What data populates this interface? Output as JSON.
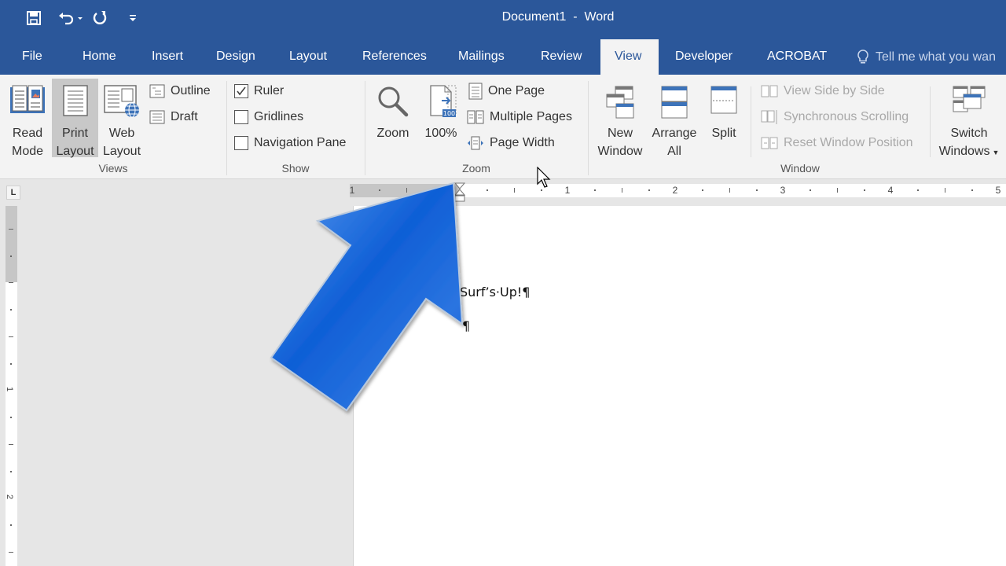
{
  "window": {
    "title": "Document1  -  Word"
  },
  "quick_access": {
    "save_icon": "save-icon",
    "undo_icon": "undo-icon",
    "redo_icon": "redo-icon",
    "customize_icon": "customize-qat-icon"
  },
  "tabs": [
    {
      "label": "File"
    },
    {
      "label": "Home"
    },
    {
      "label": "Insert"
    },
    {
      "label": "Design"
    },
    {
      "label": "Layout"
    },
    {
      "label": "References"
    },
    {
      "label": "Mailings"
    },
    {
      "label": "Review"
    },
    {
      "label": "View",
      "active": true
    },
    {
      "label": "Developer"
    },
    {
      "label": "ACROBAT"
    }
  ],
  "tell_me": {
    "placeholder": "Tell me what you want to do",
    "visible_text": "Tell me what you wan"
  },
  "ribbon": {
    "views": {
      "label": "Views",
      "read_mode": {
        "line1": "Read",
        "line2": "Mode"
      },
      "print_layout": {
        "line1": "Print",
        "line2": "Layout",
        "selected": true
      },
      "web_layout": {
        "line1": "Web",
        "line2": "Layout"
      },
      "outline": "Outline",
      "draft": "Draft"
    },
    "show": {
      "label": "Show",
      "ruler": {
        "label": "Ruler",
        "checked": true
      },
      "gridlines": {
        "label": "Gridlines",
        "checked": false
      },
      "navigation_pane": {
        "label": "Navigation Pane",
        "checked": false
      }
    },
    "zoom": {
      "label": "Zoom",
      "zoom_button": "Zoom",
      "hundred_button": "100%",
      "hundred_badge": "100",
      "one_page": "One Page",
      "multiple_pages": "Multiple Pages",
      "page_width": "Page Width"
    },
    "window": {
      "label": "Window",
      "new_window": {
        "line1": "New",
        "line2": "Window"
      },
      "arrange_all": {
        "line1": "Arrange",
        "line2": "All"
      },
      "split": "Split",
      "view_side_by_side": "View Side by Side",
      "synchronous_scrolling": "Synchronous Scrolling",
      "reset_window_position": "Reset Window Position",
      "switch_windows": {
        "line1": "Switch",
        "line2": "Windows"
      }
    }
  },
  "ruler": {
    "tab_selector": "L",
    "horizontal_numbers": [
      "1",
      "1",
      "2",
      "3",
      "4",
      "5"
    ],
    "vertical_numbers": [
      "1",
      "2"
    ]
  },
  "document": {
    "lines": [
      "Surf’s·Up!¶",
      "¶"
    ]
  },
  "annotation": {
    "arrow_color": "#1565d8",
    "points_to": "left margin indent marker on ruler"
  },
  "colors": {
    "brand": "#2b579a",
    "ribbon_bg": "#f3f3f3",
    "canvas_bg": "#e6e6e6"
  }
}
